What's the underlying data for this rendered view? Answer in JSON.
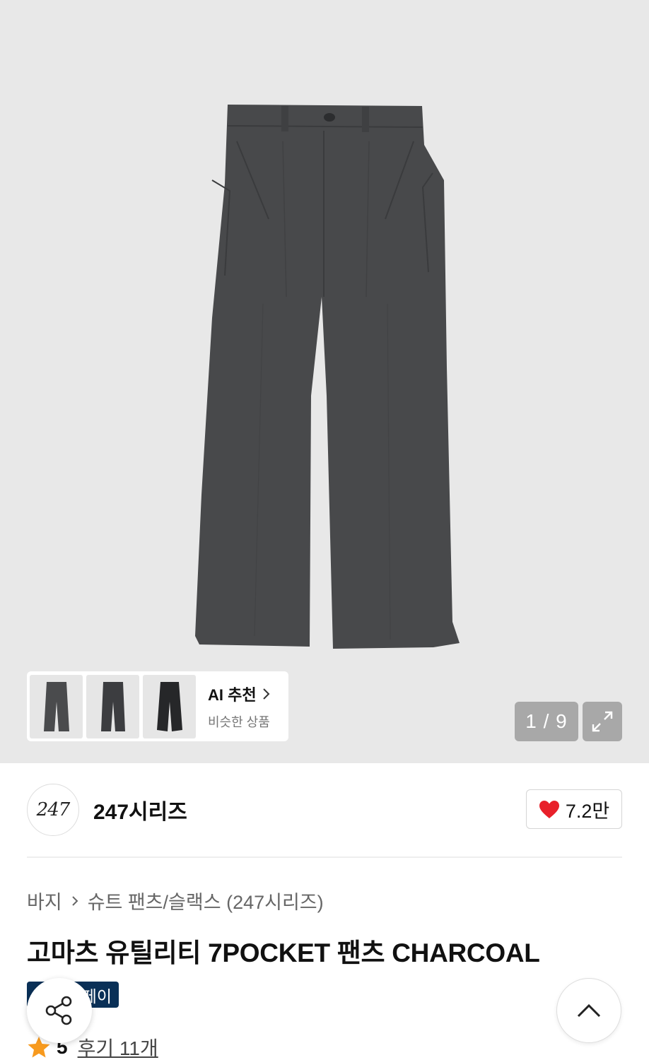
{
  "gallery": {
    "current": "1",
    "total": "9",
    "counter_text": "1 / 9"
  },
  "ai_recommend": {
    "title": "AI 추천",
    "subtitle": "비슷한 상품",
    "thumbnails": [
      "pants-thumbnail-1",
      "pants-thumbnail-2",
      "pants-thumbnail-3"
    ]
  },
  "brand": {
    "logo_text": "247",
    "name": "247시리즈",
    "likes": "7.2만"
  },
  "breadcrumb": {
    "level1": "바지",
    "level2": "슈트 팬츠/슬랙스 (247시리즈)"
  },
  "product": {
    "title": "고마츠 유틸리티 7POCKET 팬츠 CHARCOAL",
    "pay_badge": "페이",
    "rating": "5",
    "review_link": "후기 11개"
  },
  "colors": {
    "hero_bg": "#e8e8e8",
    "pants": "#48494b",
    "heart": "#e8202a",
    "star": "#f79a1e",
    "badge": "#0a3057"
  }
}
